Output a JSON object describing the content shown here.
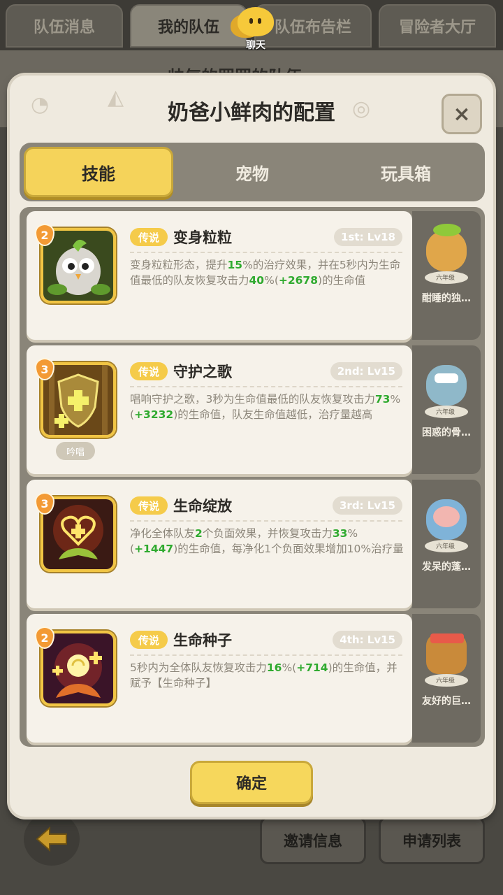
{
  "top_tabs": [
    "队伍消息",
    "我的队伍",
    "队伍布告栏",
    "冒险者大厅"
  ],
  "chat_label": "聊天",
  "bg_title": "帅气的罢罢的队伍",
  "modal": {
    "title": "奶爸小鲜肉的配置",
    "close": "×",
    "tabs": [
      "技能",
      "宠物",
      "玩具箱"
    ],
    "confirm": "确定"
  },
  "skills": [
    {
      "level": "2",
      "rarity": "传说",
      "name": "变身粒粒",
      "slot": "1st: Lv18",
      "desc_parts": [
        "变身粒粒形态，提升",
        "15",
        "%的治疗效果，并在5秒内为生命值最低的队友恢复攻击力",
        "40",
        "%(",
        "+2678",
        ")的生命值"
      ],
      "pet_name": "酣睡的独…",
      "pet_badge": "六年级"
    },
    {
      "level": "3",
      "rarity": "传说",
      "name": "守护之歌",
      "slot": "2nd: Lv15",
      "sub_tag": "吟唱",
      "desc_parts": [
        "唱响守护之歌，3秒为生命值最低的队友恢复攻击力",
        "73",
        "%(",
        "+3232",
        ")的生命值，队友生命值越低，治疗量越高"
      ],
      "pet_name": "困惑的骨…",
      "pet_badge": "六年级"
    },
    {
      "level": "3",
      "rarity": "传说",
      "name": "生命绽放",
      "slot": "3rd: Lv15",
      "desc_parts": [
        "净化全体队友",
        "2",
        "个负面效果，并恢复攻击力",
        "33",
        "%(",
        "+1447",
        ")的生命值，每净化1个负面效果增加10%治疗量"
      ],
      "pet_name": "发呆的蓬…",
      "pet_badge": "六年级"
    },
    {
      "level": "2",
      "rarity": "传说",
      "name": "生命种子",
      "slot": "4th: Lv15",
      "desc_parts": [
        "5秒内为全体队友恢复攻击力",
        "16",
        "%(",
        "+714",
        ")的生命值，并赋予【生命种子】"
      ],
      "pet_name": "友好的巨…",
      "pet_badge": "六年级"
    }
  ],
  "bottom": {
    "invite": "邀请信息",
    "apply": "申请列表"
  },
  "colors": {
    "accent": "#f5d35a",
    "highlight": "#2faa2f",
    "badge": "#f39a34"
  }
}
